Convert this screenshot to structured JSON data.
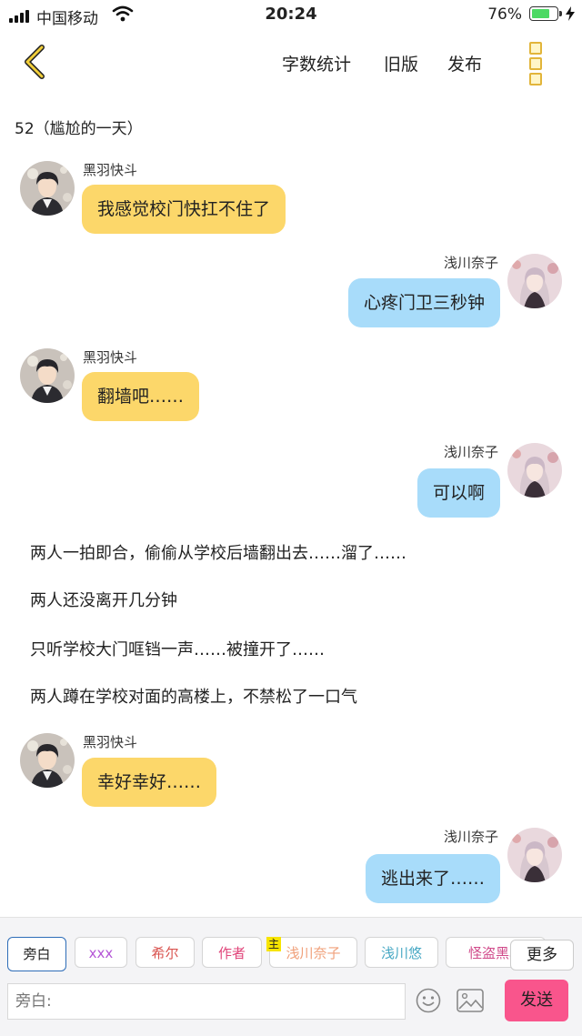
{
  "status_bar": {
    "carrier": "中国移动",
    "time": "20:24",
    "battery_percent": "76%",
    "battery_level": 0.76
  },
  "nav": {
    "word_count": "字数统计",
    "old_version": "旧版",
    "publish": "发布"
  },
  "chapter_title": "52（尴尬的一天）",
  "messages": [
    {
      "speaker": "黑羽快斗",
      "text": "我感觉校门快扛不住了"
    },
    {
      "speaker": "浅川奈子",
      "text": "心疼门卫三秒钟"
    },
    {
      "speaker": "黑羽快斗",
      "text": "翻墙吧……"
    },
    {
      "speaker": "浅川奈子",
      "text": "可以啊"
    },
    {
      "narration": "两人一拍即合，偷偷从学校后墙翻出去……溜了……"
    },
    {
      "narration": "两人还没离开几分钟"
    },
    {
      "narration": "只听学校大门哐铛一声……被撞开了……"
    },
    {
      "narration": "两人蹲在学校对面的高楼上，不禁松了一口气"
    },
    {
      "speaker": "黑羽快斗",
      "text": "幸好幸好……"
    },
    {
      "speaker": "浅川奈子",
      "text": "逃出来了……"
    }
  ],
  "characters": [
    {
      "label": "旁白",
      "color": "#222222"
    },
    {
      "label": "xxx",
      "color": "#b455d6"
    },
    {
      "label": "希尔",
      "color": "#d9534f"
    },
    {
      "label": "作者",
      "color": "#e0457a"
    },
    {
      "label": "浅川奈子",
      "color": "#f0a07a"
    },
    {
      "label": "浅川悠",
      "color": "#47a8c4"
    },
    {
      "label": "怪盗黑羽",
      "color": "#d04a8a"
    }
  ],
  "host_badge": "主",
  "more_label": "更多",
  "input_placeholder": "旁白:",
  "send_label": "发送",
  "colors": {
    "accent_yellow": "#fcd76a",
    "accent_blue": "#a8dcfa",
    "send_pink": "#f9558c",
    "battery_green": "#4cd964"
  }
}
